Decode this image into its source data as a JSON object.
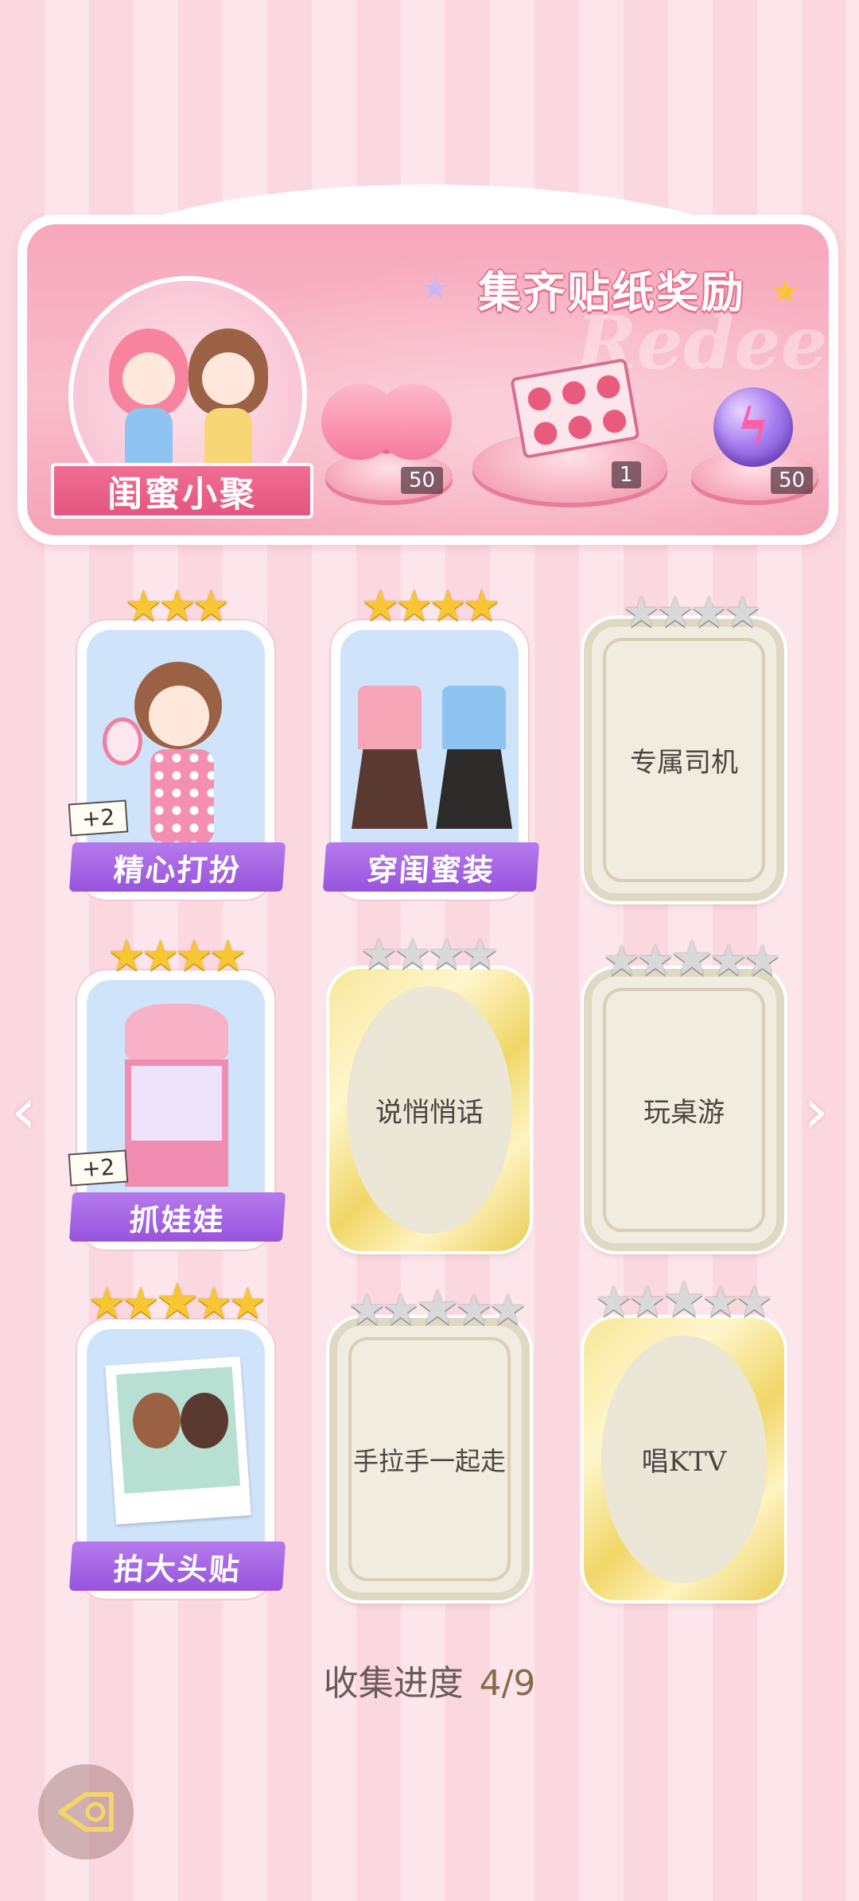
{
  "banner": {
    "title": "集齐贴纸奖励",
    "watermark": "Redeem",
    "group_label": "闺蜜小聚",
    "rewards": [
      {
        "icon": "heart-gem-icon",
        "count": "50"
      },
      {
        "icon": "gift-box-icon",
        "count": "1"
      },
      {
        "icon": "energy-orb-icon",
        "count": "50"
      }
    ]
  },
  "cards": [
    {
      "label": "精心打扮",
      "state": "collected",
      "stars_total": 3,
      "stars_lit": 3,
      "badge": "+2",
      "art": "girl-mirror"
    },
    {
      "label": "穿闺蜜装",
      "state": "collected",
      "stars_total": 4,
      "stars_lit": 4,
      "badge": "",
      "art": "outfits"
    },
    {
      "label": "专属司机",
      "state": "locked",
      "frame": "silver",
      "stars_total": 4,
      "stars_lit": 0
    },
    {
      "label": "抓娃娃",
      "state": "collected",
      "stars_total": 4,
      "stars_lit": 4,
      "badge": "+2",
      "art": "claw-machine"
    },
    {
      "label": "说悄悄话",
      "state": "locked",
      "frame": "gold",
      "stars_total": 4,
      "stars_lit": 0
    },
    {
      "label": "玩桌游",
      "state": "locked",
      "frame": "silver",
      "stars_total": 5,
      "stars_lit": 0
    },
    {
      "label": "拍大头贴",
      "state": "collected",
      "stars_total": 5,
      "stars_lit": 5,
      "badge": "",
      "art": "photo-booth"
    },
    {
      "label": "手拉手一起走",
      "state": "locked",
      "frame": "silver",
      "stars_total": 5,
      "stars_lit": 0
    },
    {
      "label": "唱KTV",
      "state": "locked",
      "frame": "gold",
      "stars_total": 5,
      "stars_lit": 0
    }
  ],
  "progress": {
    "label": "收集进度",
    "value": "4/9"
  },
  "nav": {
    "prev_icon": "chevron-left-icon",
    "next_icon": "chevron-right-icon",
    "back_icon": "back-arrow-icon"
  }
}
